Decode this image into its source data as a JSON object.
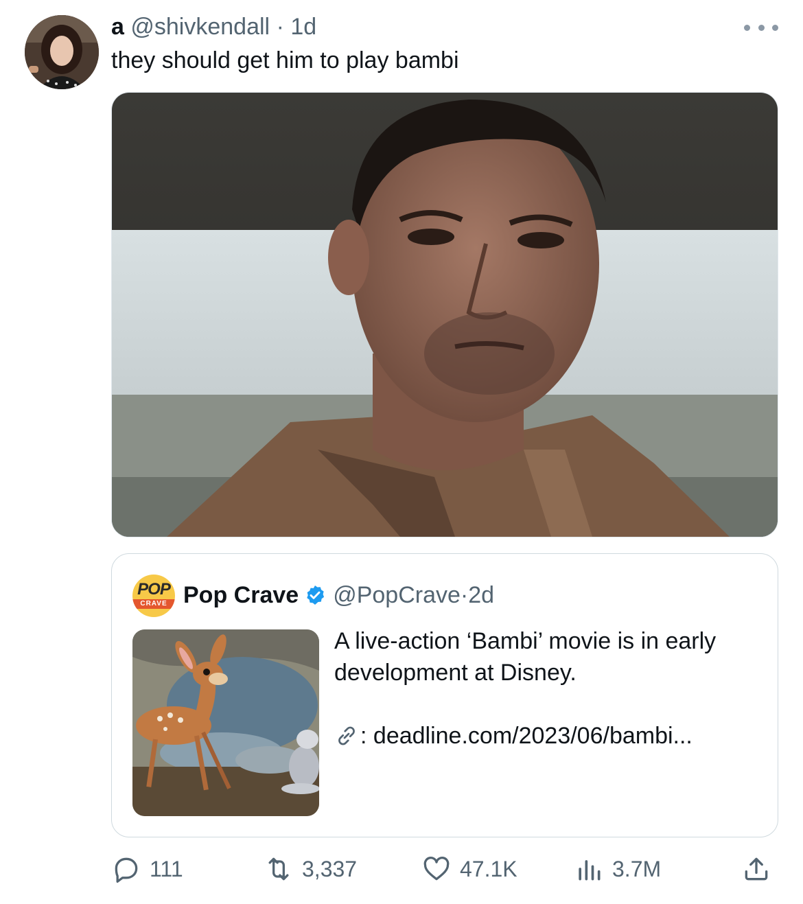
{
  "tweet": {
    "display_name": "a",
    "handle": "@shivkendall",
    "separator": "·",
    "time": "1d",
    "text": "they should get him to play bambi",
    "avatar_icon": "user-avatar",
    "more_icon": "more-options-icon"
  },
  "quoted": {
    "logo_top": "POP",
    "logo_bottom": "CRAVE",
    "display_name": "Pop Crave",
    "verified_icon": "verified-badge-icon",
    "handle": "@PopCrave",
    "separator": "·",
    "time": "2d",
    "text": "A live-action ‘Bambi’ movie is in early development at Disney.",
    "link_prefix": ": ",
    "link": "deadline.com/2023/06/bambi..."
  },
  "actions": {
    "replies": "111",
    "retweets": "3,337",
    "likes": "47.1K",
    "views": "3.7M"
  },
  "colors": {
    "text": "#0f1419",
    "muted": "#536471",
    "verified": "#1d9bf0",
    "border": "#cfd9de"
  }
}
